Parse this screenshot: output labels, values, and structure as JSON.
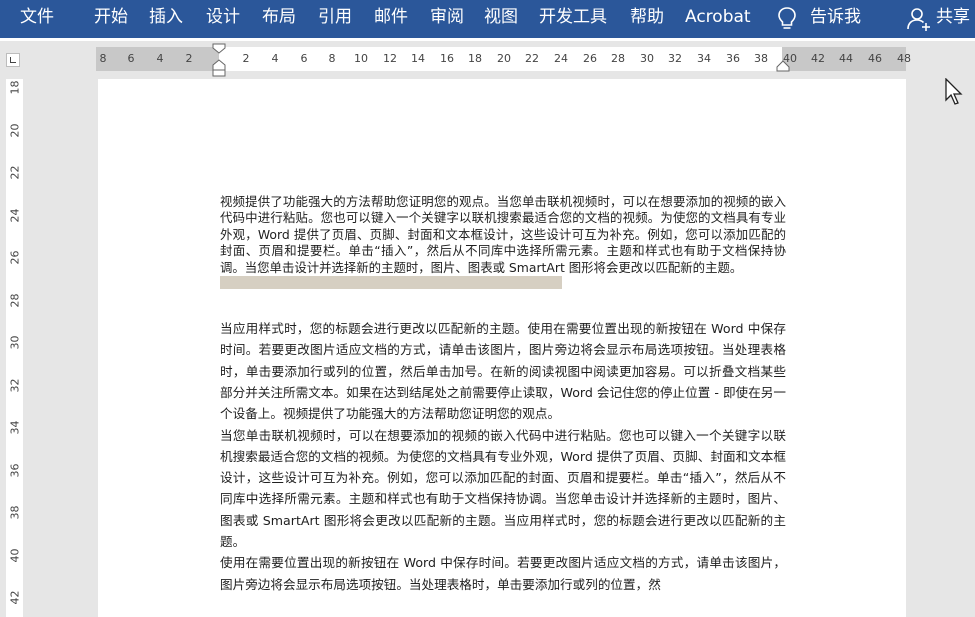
{
  "ribbon": {
    "tabs": [
      "文件",
      "开始",
      "插入",
      "设计",
      "布局",
      "引用",
      "邮件",
      "审阅",
      "视图",
      "开发工具",
      "帮助",
      "Acrobat"
    ],
    "tell_me": "告诉我",
    "share": "共享"
  },
  "ruler": {
    "h_ticks": [
      "8",
      "6",
      "4",
      "2",
      "2",
      "4",
      "6",
      "8",
      "10",
      "12",
      "14",
      "16",
      "18",
      "20",
      "22",
      "24",
      "26",
      "28",
      "30",
      "32",
      "34",
      "36",
      "38",
      "40",
      "42",
      "44",
      "46",
      "48"
    ],
    "v_ticks": [
      "18",
      "20",
      "22",
      "24",
      "26",
      "28",
      "30",
      "32",
      "34",
      "36",
      "38",
      "40",
      "42"
    ]
  },
  "document": {
    "para1": "视频提供了功能强大的方法帮助您证明您的观点。当您单击联机视频时，可以在想要添加的视频的嵌入代码中进行粘贴。您也可以键入一个关键字以联机搜索最适合您的文档的视频。为使您的文档具有专业外观，Word 提供了页眉、页脚、封面和文本框设计，这些设计可互为补充。例如，您可以添加匹配的封面、页眉和提要栏。单击“插入”，然后从不同库中选择所需元素。主题和样式也有助于文档保持协调。当您单击设计并选择新的主题时，图片、图表或 SmartArt 图形将会更改以匹配新的主题。",
    "para2": "当应用样式时，您的标题会进行更改以匹配新的主题。使用在需要位置出现的新按钮在 Word 中保存时间。若要更改图片适应文档的方式，请单击该图片，图片旁边将会显示布局选项按钮。当处理表格时，单击要添加行或列的位置，然后单击加号。在新的阅读视图中阅读更加容易。可以折叠文档某些部分并关注所需文本。如果在达到结尾处之前需要停止读取，Word 会记住您的停止位置 - 即使在另一个设备上。视频提供了功能强大的方法帮助您证明您的观点。",
    "para3": "当您单击联机视频时，可以在想要添加的视频的嵌入代码中进行粘贴。您也可以键入一个关键字以联机搜索最适合您的文档的视频。为使您的文档具有专业外观，Word 提供了页眉、页脚、封面和文本框设计，这些设计可互为补充。例如，您可以添加匹配的封面、页眉和提要栏。单击“插入”，然后从不同库中选择所需元素。主题和样式也有助于文档保持协调。当您单击设计并选择新的主题时，图片、图表或 SmartArt 图形将会更改以匹配新的主题。当应用样式时，您的标题会进行更改以匹配新的主题。",
    "para4": "使用在需要位置出现的新按钮在 Word 中保存时间。若要更改图片适应文档的方式，请单击该图片，图片旁边将会显示布局选项按钮。当处理表格时，单击要添加行或列的位置，然"
  },
  "colors": {
    "ribbon": "#2b579a",
    "ruler_margin": "#c8c8c8",
    "highlight": "#d6cfc2"
  }
}
